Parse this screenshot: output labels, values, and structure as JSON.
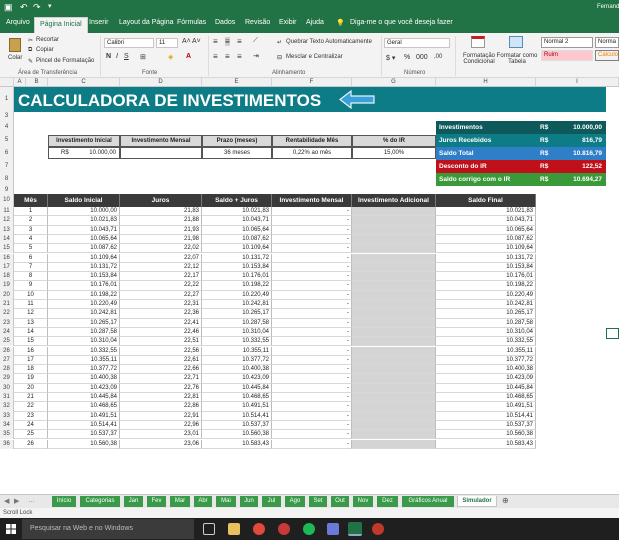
{
  "titlebar": {
    "user": "Fernando"
  },
  "menu": {
    "tabs": [
      "Arquivo",
      "Página Inicial",
      "Inserir",
      "Layout da Página",
      "Fórmulas",
      "Dados",
      "Revisão",
      "Exibir",
      "Ajuda"
    ],
    "tell_me": "Diga-me o que você deseja fazer"
  },
  "ribbon": {
    "paste": "Colar",
    "cut": "Recortar",
    "copy": "Copiar",
    "format_painter": "Pincel de Formatação",
    "font_name": "Calibri",
    "font_size": "11",
    "wrap_text": "Quebrar Texto Automaticamente",
    "merge_center": "Mesclar e Centralizar",
    "number_format": "Geral",
    "cond_format": "Formatação Condicional",
    "format_table": "Formatar como Tabela",
    "style_normal2": "Normal 2",
    "style_normal": "Norma",
    "style_bad": "Ruim",
    "style_calc": "Cálculo",
    "groups": [
      "Área de Transferência",
      "Fonte",
      "Alinhamento",
      "Número"
    ]
  },
  "columns": [
    "A",
    "B",
    "C",
    "D",
    "E",
    "F",
    "G",
    "H",
    "I"
  ],
  "rows": [
    "1",
    "3",
    "4",
    "5",
    "6",
    "7",
    "8",
    "9",
    "10",
    "11",
    "12",
    "13",
    "14",
    "15",
    "16",
    "17",
    "18",
    "19",
    "20",
    "21",
    "22",
    "23",
    "24",
    "25",
    "26",
    "27",
    "28",
    "29",
    "30",
    "31",
    "32",
    "33",
    "34",
    "35",
    "36"
  ],
  "banner": {
    "title": "CALCULADORA DE INVESTIMENTOS",
    "arrow_color": "#3aa0d8"
  },
  "inputs": {
    "headers": [
      "Investimento Inicial",
      "Investimento Mensal",
      "Prazo (meses)",
      "Rentabilidade Mês",
      "% do IR"
    ],
    "currency": "R$",
    "initial": "10.000,00",
    "monthly": "",
    "term": "36 meses",
    "rate": "0,22% ao mês",
    "ir": "15,00%"
  },
  "summary": [
    {
      "label": "Investimentos",
      "currency": "R$",
      "value": "10.000,00",
      "color": "#0e5a5a"
    },
    {
      "label": "Juros Recebidos",
      "currency": "R$",
      "value": "816,79",
      "color": "#0e7c86"
    },
    {
      "label": "Saldo Total",
      "currency": "R$",
      "value": "10.816,79",
      "color": "#2f7fc8"
    },
    {
      "label": "Desconto do IR",
      "currency": "R$",
      "value": "122,52",
      "color": "#c0101a"
    },
    {
      "label": "Saldo corrigo com o IR",
      "currency": "R$",
      "value": "10.694,27",
      "color": "#3a9a3a"
    }
  ],
  "table": {
    "headers": [
      "Mês",
      "Saldo Inicial",
      "Juros",
      "Saldo + Juros",
      "Investimento Mensal",
      "Investimento Adicional",
      "Saldo Final"
    ],
    "rows": [
      [
        "1",
        "10.000,00",
        "21,83",
        "10.021,83",
        "-",
        "",
        "10.021,83"
      ],
      [
        "2",
        "10.021,83",
        "21,88",
        "10.043,71",
        "-",
        "",
        "10.043,71"
      ],
      [
        "3",
        "10.043,71",
        "21,93",
        "10.065,64",
        "-",
        "",
        "10.065,64"
      ],
      [
        "4",
        "10.065,64",
        "21,98",
        "10.087,62",
        "-",
        "",
        "10.087,62"
      ],
      [
        "5",
        "10.087,62",
        "22,02",
        "10.109,64",
        "-",
        "",
        "10.109,64"
      ],
      [
        "6",
        "10.109,64",
        "22,07",
        "10.131,72",
        "-",
        "",
        "10.131,72"
      ],
      [
        "7",
        "10.131,72",
        "22,12",
        "10.153,84",
        "-",
        "",
        "10.153,84"
      ],
      [
        "8",
        "10.153,84",
        "22,17",
        "10.176,01",
        "-",
        "",
        "10.176,01"
      ],
      [
        "9",
        "10.176,01",
        "22,22",
        "10.198,22",
        "-",
        "",
        "10.198,22"
      ],
      [
        "10",
        "10.198,22",
        "22,27",
        "10.220,49",
        "-",
        "",
        "10.220,49"
      ],
      [
        "11",
        "10.220,49",
        "22,31",
        "10.242,81",
        "-",
        "",
        "10.242,81"
      ],
      [
        "12",
        "10.242,81",
        "22,36",
        "10.265,17",
        "-",
        "",
        "10.265,17"
      ],
      [
        "13",
        "10.265,17",
        "22,41",
        "10.287,58",
        "-",
        "",
        "10.287,58"
      ],
      [
        "14",
        "10.287,58",
        "22,46",
        "10.310,04",
        "-",
        "",
        "10.310,04"
      ],
      [
        "15",
        "10.310,04",
        "22,51",
        "10.332,55",
        "-",
        "",
        "10.332,55"
      ],
      [
        "16",
        "10.332,55",
        "22,56",
        "10.355,11",
        "-",
        "",
        "10.355,11"
      ],
      [
        "17",
        "10.355,11",
        "22,61",
        "10.377,72",
        "-",
        "",
        "10.377,72"
      ],
      [
        "18",
        "10.377,72",
        "22,66",
        "10.400,38",
        "-",
        "",
        "10.400,38"
      ],
      [
        "19",
        "10.400,38",
        "22,71",
        "10.423,09",
        "-",
        "",
        "10.423,09"
      ],
      [
        "20",
        "10.423,09",
        "22,76",
        "10.445,84",
        "-",
        "",
        "10.445,84"
      ],
      [
        "21",
        "10.445,84",
        "22,81",
        "10.468,65",
        "-",
        "",
        "10.468,65"
      ],
      [
        "22",
        "10.468,65",
        "22,86",
        "10.491,51",
        "-",
        "",
        "10.491,51"
      ],
      [
        "23",
        "10.491,51",
        "22,91",
        "10.514,41",
        "-",
        "",
        "10.514,41"
      ],
      [
        "24",
        "10.514,41",
        "22,96",
        "10.537,37",
        "-",
        "",
        "10.537,37"
      ],
      [
        "25",
        "10.537,37",
        "23,01",
        "10.560,38",
        "-",
        "",
        "10.560,38"
      ],
      [
        "26",
        "10.560,38",
        "23,06",
        "10.583,43",
        "-",
        "",
        "10.583,43"
      ]
    ]
  },
  "sheet_tabs": [
    "Início",
    "Categorias",
    "Jan",
    "Fev",
    "Mar",
    "Abr",
    "Mai",
    "Jun",
    "Jul",
    "Ago",
    "Set",
    "Out",
    "Nov",
    "Dez",
    "Gráficos Anual",
    "Simulador"
  ],
  "status": "Scroll Lock",
  "taskbar": {
    "search": "Pesquisar na Web e no Windows"
  }
}
